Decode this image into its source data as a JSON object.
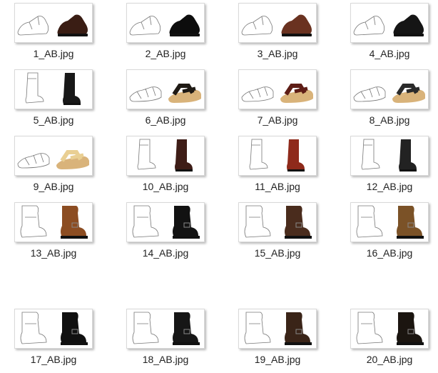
{
  "folder": {
    "files": [
      {
        "name": "1_AB.jpg",
        "kind": "shoe",
        "color": "#3a1d14"
      },
      {
        "name": "2_AB.jpg",
        "kind": "shoe",
        "color": "#0d0d0d"
      },
      {
        "name": "3_AB.jpg",
        "kind": "shoe",
        "color": "#6a3220"
      },
      {
        "name": "4_AB.jpg",
        "kind": "shoe",
        "color": "#151515"
      },
      {
        "name": "5_AB.jpg",
        "kind": "boot",
        "color": "#181818"
      },
      {
        "name": "6_AB.jpg",
        "kind": "sandal",
        "color": "#1f1a14"
      },
      {
        "name": "7_AB.jpg",
        "kind": "sandal",
        "color": "#5e1d16"
      },
      {
        "name": "8_AB.jpg",
        "kind": "sandal",
        "color": "#2a2a2a"
      },
      {
        "name": "9_AB.jpg",
        "kind": "sandal",
        "color": "#e9cf93"
      },
      {
        "name": "10_AB.jpg",
        "kind": "boot",
        "color": "#3e1d17"
      },
      {
        "name": "11_AB.jpg",
        "kind": "boot",
        "color": "#8f2a1b"
      },
      {
        "name": "12_AB.jpg",
        "kind": "boot",
        "color": "#222222"
      },
      {
        "name": "13_AB.jpg",
        "kind": "bootbig",
        "color": "#8c4d22"
      },
      {
        "name": "14_AB.jpg",
        "kind": "bootbig",
        "color": "#121212"
      },
      {
        "name": "15_AB.jpg",
        "kind": "bootbig",
        "color": "#4a2c1d"
      },
      {
        "name": "16_AB.jpg",
        "kind": "bootbig",
        "color": "#7b5227"
      },
      {
        "name": "17_AB.jpg",
        "kind": "bootbig",
        "color": "#101010"
      },
      {
        "name": "18_AB.jpg",
        "kind": "bootbig",
        "color": "#161616"
      },
      {
        "name": "19_AB.jpg",
        "kind": "bootbig",
        "color": "#3a2418"
      },
      {
        "name": "20_AB.jpg",
        "kind": "bootbig",
        "color": "#1b1510"
      }
    ]
  }
}
